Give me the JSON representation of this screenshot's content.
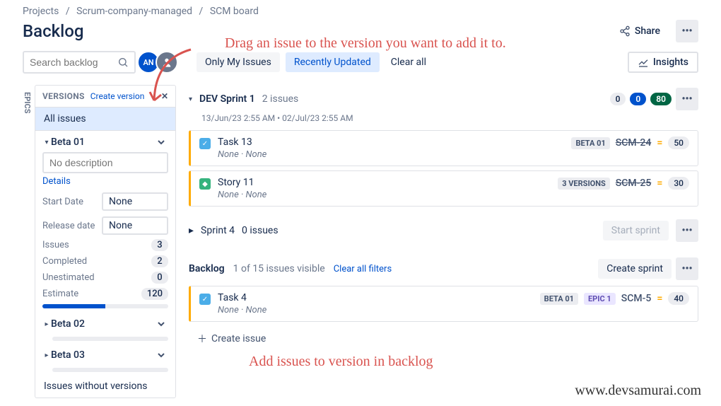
{
  "breadcrumb": {
    "projects": "Projects",
    "project": "Scrum-company-managed",
    "board": "SCM board"
  },
  "page_title": "Backlog",
  "header": {
    "share": "Share"
  },
  "search": {
    "placeholder": "Search backlog"
  },
  "avatars": {
    "initials1": "AN"
  },
  "filters": {
    "only_my": "Only My Issues",
    "recent": "Recently Updated",
    "clear": "Clear all"
  },
  "insights": {
    "label": "Insights"
  },
  "epics_tab": "EPICS",
  "versions": {
    "header": "VERSIONS",
    "create": "Create version",
    "all": "All issues",
    "beta01": {
      "name": "Beta 01",
      "no_desc": "No description",
      "details": "Details",
      "start_label": "Start Date",
      "start_val": "None",
      "release_label": "Release date",
      "release_val": "None",
      "issues_label": "Issues",
      "issues": "3",
      "completed_label": "Completed",
      "completed": "2",
      "unest_label": "Unestimated",
      "unest": "0",
      "est_label": "Estimate",
      "est": "120"
    },
    "beta02": "Beta 02",
    "beta03": "Beta 03",
    "nov": "Issues without versions"
  },
  "sprint1": {
    "name": "DEV Sprint 1",
    "count": "2 issues",
    "dates": "13/Jun/23 2:55 AM • 02/Jul/23 2:55 AM",
    "pills": {
      "grey": "0",
      "blue": "0",
      "green": "80"
    }
  },
  "issue1": {
    "title": "Task 13",
    "meta1": "None",
    "meta2": "None",
    "badge": "BETA 01",
    "key": "SCM-24",
    "est": "50"
  },
  "issue2": {
    "title": "Story 11",
    "meta1": "None",
    "meta2": "None",
    "badge": "3 VERSIONS",
    "key": "SCM-25",
    "est": "30"
  },
  "sprint4": {
    "name": "Sprint 4",
    "count": "0 issues",
    "start": "Start sprint"
  },
  "backlog": {
    "title": "Backlog",
    "info": "1 of 15 issues visible",
    "clear": "Clear all filters",
    "create": "Create sprint"
  },
  "issue3": {
    "title": "Task 4",
    "meta1": "None",
    "meta2": "None",
    "badge1": "BETA 01",
    "badge2": "EPIC 1",
    "key": "SCM-5",
    "est": "40"
  },
  "create_issue": "Create issue",
  "annotation1": "Drag an issue to the version you want to add it to.",
  "annotation2": "Add issues to version in backlog",
  "footer": "www.devsamurai.com"
}
